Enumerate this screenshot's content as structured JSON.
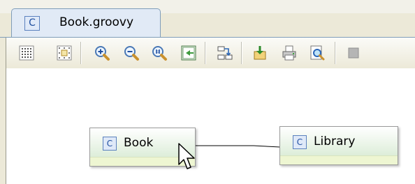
{
  "tab": {
    "icon": "class-icon",
    "glyph": "C",
    "title": "Book.groovy"
  },
  "toolbar": {
    "buttons": [
      "grid-icon",
      "snap-to-grid-icon",
      "zoom-in-icon",
      "zoom-out-icon",
      "zoom-actual-icon",
      "fit-to-window-icon",
      "auto-layout-icon",
      "export-icon",
      "print-icon",
      "print-preview-icon",
      "more-icon"
    ]
  },
  "diagram": {
    "nodes": [
      {
        "id": "book",
        "glyph": "C",
        "label": "Book"
      },
      {
        "id": "library",
        "glyph": "C",
        "label": "Library"
      }
    ]
  },
  "colors": {
    "tab_border": "#7f9db9",
    "node_header": "#dcedd8",
    "class_icon": "#1f4fa0"
  }
}
